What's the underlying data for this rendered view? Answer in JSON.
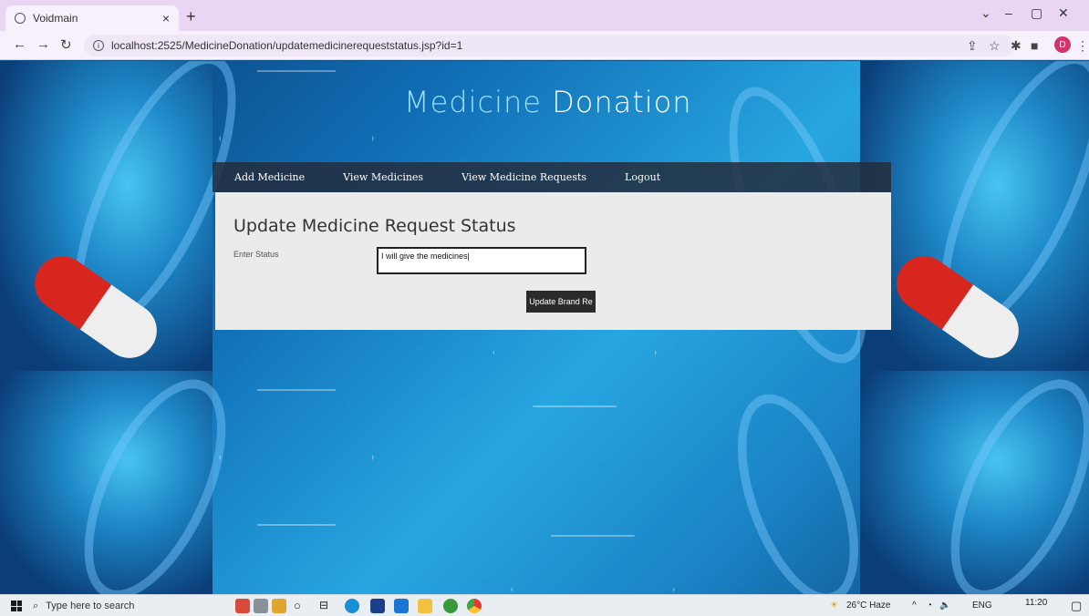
{
  "browser": {
    "tab_title": "Voidmain",
    "url": "localhost:2525/MedicineDonation/updatemedicinerequeststatus.jsp?id=1",
    "profile_initial": "D"
  },
  "site": {
    "title_part1": "Medicine",
    "title_part2": "Donation",
    "nav": [
      "Add Medicine",
      "View Medicines",
      "View Medicine Requests",
      "Logout"
    ]
  },
  "form": {
    "heading": "Update Medicine Request Status",
    "status_label": "Enter Status",
    "status_value": "I will give the medicines|",
    "submit_label": "Update Brand Re"
  },
  "taskbar": {
    "search_placeholder": "Type here to search",
    "weather": "26°C  Haze",
    "lang": "ENG",
    "time": "11:20"
  }
}
